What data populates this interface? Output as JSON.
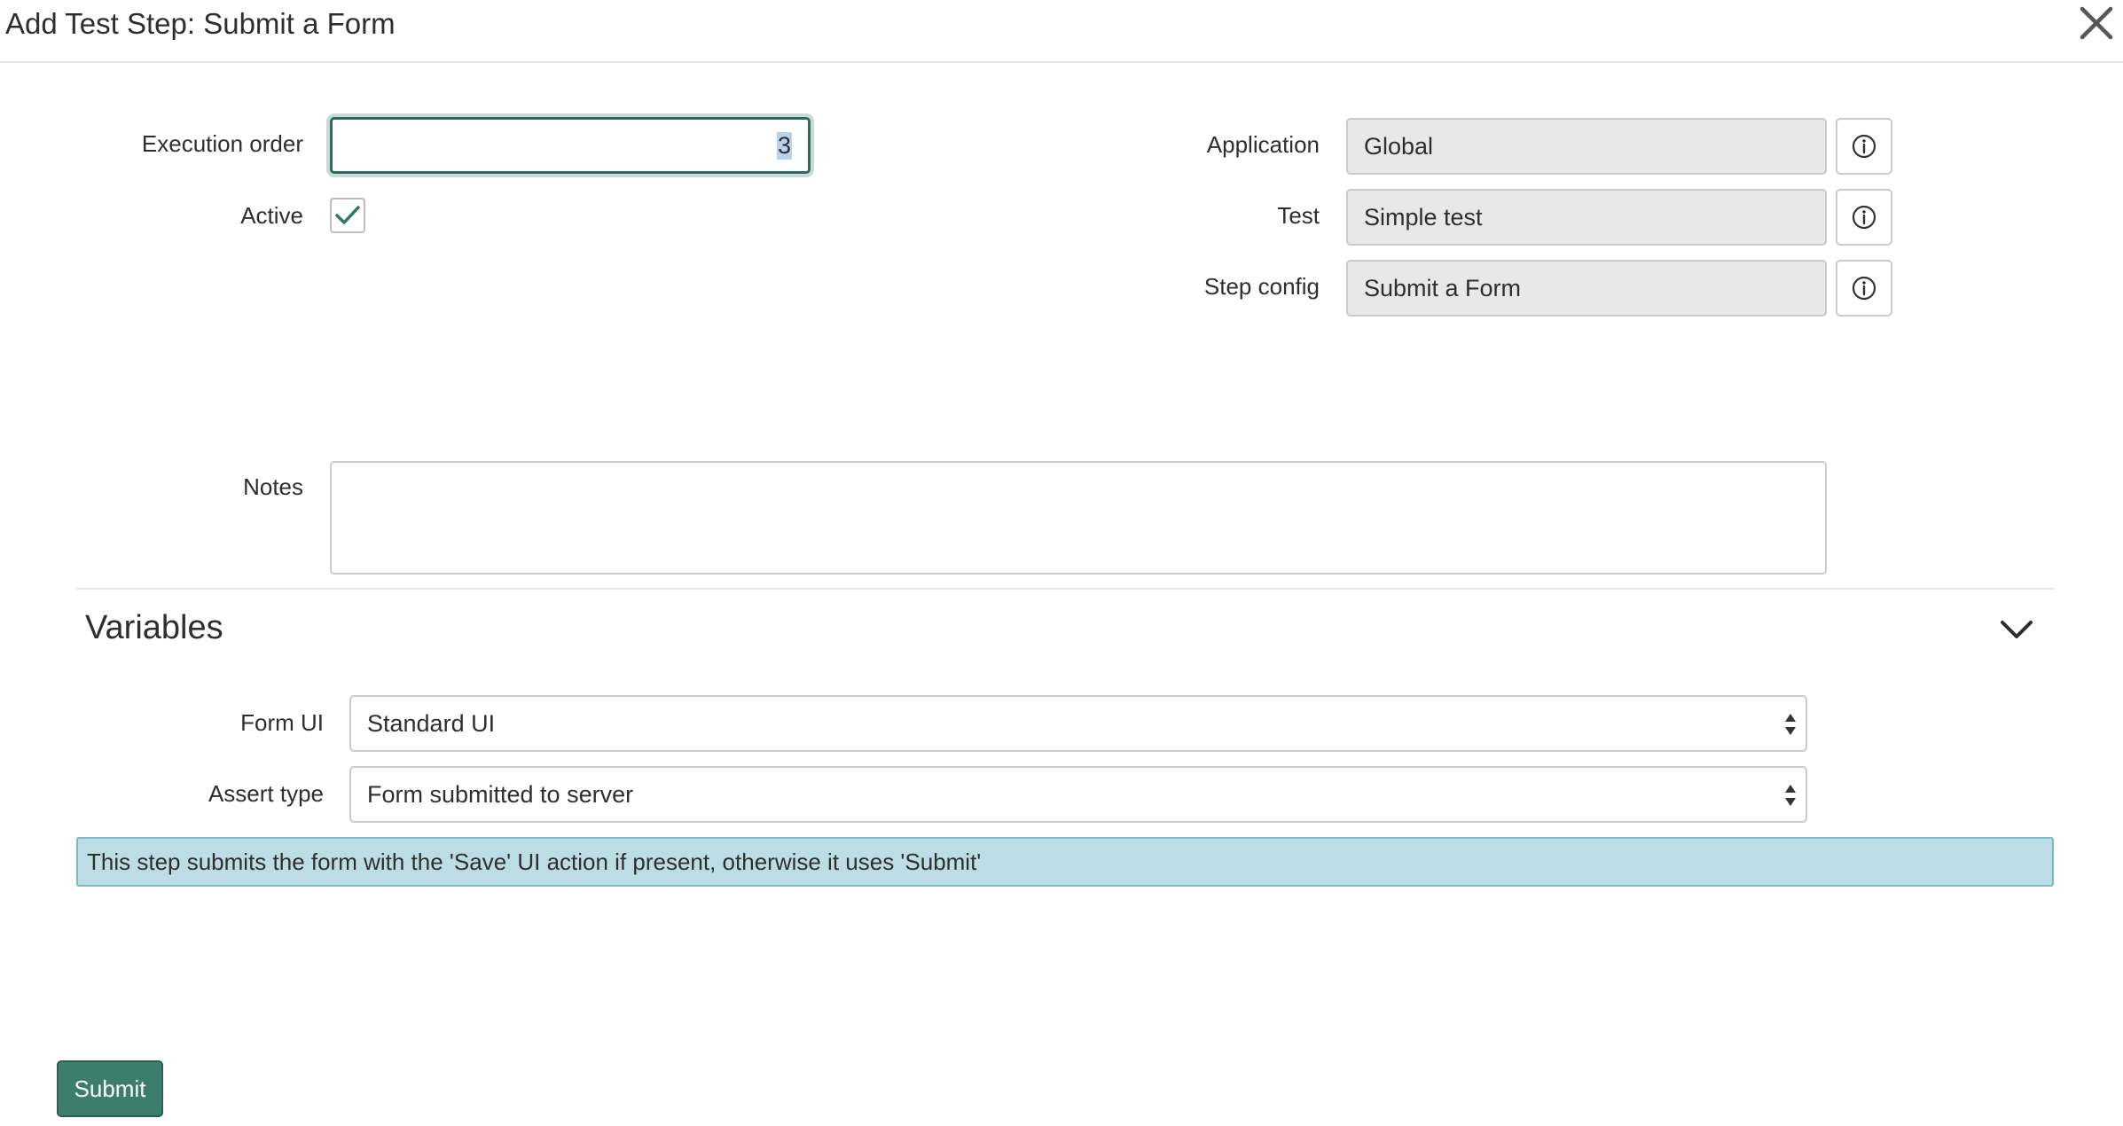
{
  "header": {
    "title": "Add Test Step: Submit a Form"
  },
  "form": {
    "execution_order": {
      "label": "Execution order",
      "value": "3"
    },
    "active": {
      "label": "Active",
      "checked": true
    },
    "application": {
      "label": "Application",
      "value": "Global"
    },
    "test": {
      "label": "Test",
      "value": "Simple test"
    },
    "step_config": {
      "label": "Step config",
      "value": "Submit a Form"
    },
    "notes": {
      "label": "Notes",
      "value": ""
    }
  },
  "variables": {
    "title": "Variables",
    "form_ui": {
      "label": "Form UI",
      "value": "Standard UI"
    },
    "assert_type": {
      "label": "Assert type",
      "value": "Form submitted to server"
    },
    "info_message": "This step submits the form with the 'Save' UI action if present, otherwise it uses 'Submit'"
  },
  "actions": {
    "submit_label": "Submit"
  },
  "colors": {
    "accent": "#3c7d6c",
    "info_background": "#bcdde5",
    "readonly_background": "#e8e8e8"
  },
  "icons": [
    "close-icon",
    "checkmark-icon",
    "info-icon",
    "chevron-down-icon",
    "select-arrows-icon"
  ]
}
